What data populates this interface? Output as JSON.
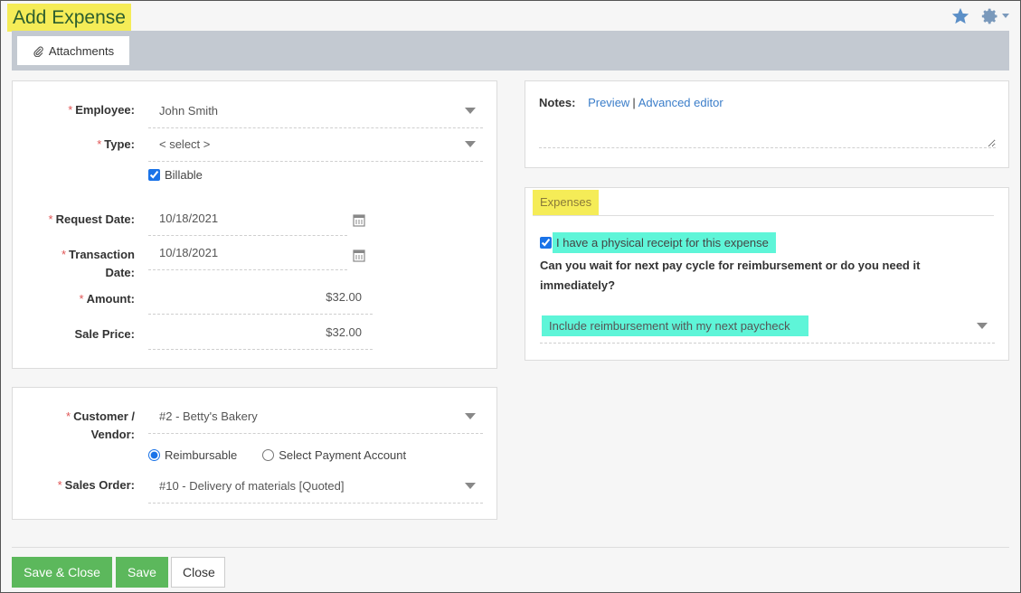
{
  "page": {
    "title": "Add Expense",
    "icons": [
      "star-icon",
      "gear-icon",
      "chevron-down-icon"
    ]
  },
  "toolbar": {
    "attachments_label": "Attachments",
    "attachments_icon": "paperclip-icon"
  },
  "details": {
    "employee": {
      "label": "Employee:",
      "required": true,
      "value": "John Smith"
    },
    "type": {
      "label": "Type:",
      "required": true,
      "value": "< select >"
    },
    "billable": {
      "label": "Billable",
      "checked": true
    },
    "request_date": {
      "label": "Request Date:",
      "required": true,
      "value": "10/18/2021"
    },
    "transaction_date": {
      "label_line1": "Transaction",
      "label_line2": "Date:",
      "required": true,
      "value": "10/18/2021"
    },
    "amount": {
      "label": "Amount:",
      "required": true,
      "value": "$32.00"
    },
    "sale_price": {
      "label": "Sale Price:",
      "required": false,
      "value": "$32.00"
    }
  },
  "customer": {
    "customer_vendor": {
      "label_line1": "Customer /",
      "label_line2": "Vendor:",
      "required": true,
      "value": "#2 - Betty's Bakery"
    },
    "payment_options": [
      {
        "label": "Reimbursable",
        "selected": true
      },
      {
        "label": "Select Payment Account",
        "selected": false
      }
    ],
    "sales_order": {
      "label": "Sales Order:",
      "required": true,
      "value": "#10 - Delivery of materials [Quoted]"
    }
  },
  "notes": {
    "label": "Notes:",
    "preview_link": "Preview",
    "separator": "|",
    "advanced_link": "Advanced editor",
    "value": ""
  },
  "expenses": {
    "section_title": "Expenses",
    "receipt_checkbox": {
      "label": "I have a physical receipt for this expense",
      "checked": true
    },
    "question": "Can you wait for next pay cycle for reimbursement or do you need it immediately?",
    "reimbursement_select": {
      "value": "Include reimbursement with my next paycheck"
    }
  },
  "required_marker": "*",
  "footer": {
    "save_close_label": "Save & Close",
    "save_label": "Save",
    "close_label": "Close"
  }
}
